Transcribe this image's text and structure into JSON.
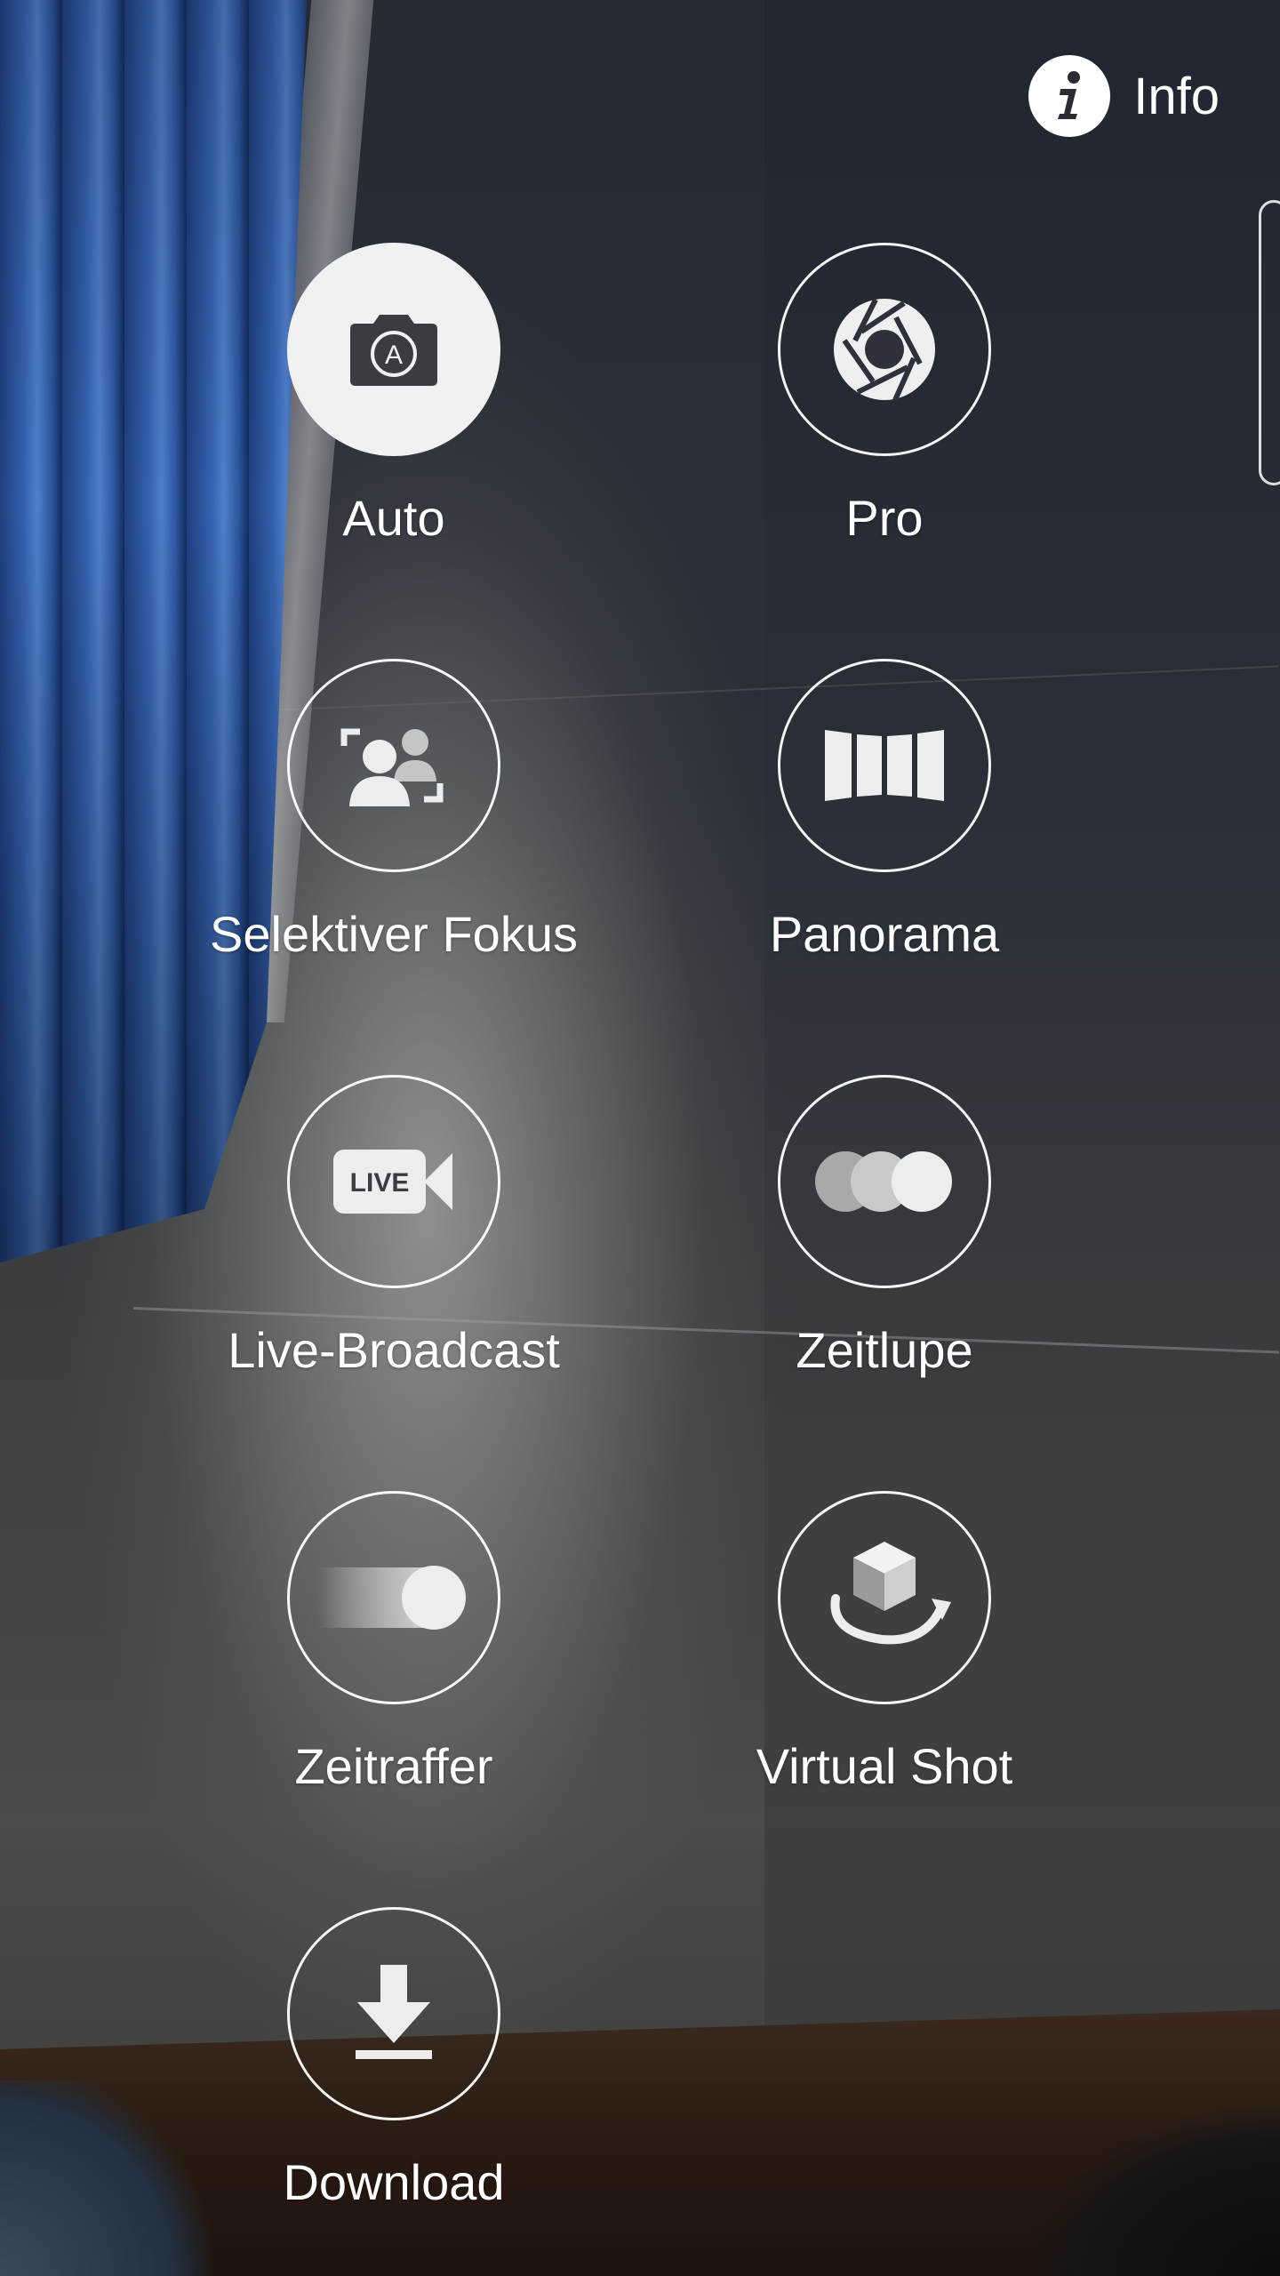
{
  "info": {
    "label": "Info",
    "icon": "info-icon"
  },
  "modes": [
    {
      "label": "Auto",
      "icon": "camera-auto-icon",
      "selected": true
    },
    {
      "label": "Pro",
      "icon": "aperture-icon"
    },
    {
      "label": "Selektiver Fokus",
      "icon": "selective-focus-icon"
    },
    {
      "label": "Panorama",
      "icon": "panorama-icon"
    },
    {
      "label": "Live-Broadcast",
      "icon": "live-video-icon",
      "icon_text": "LIVE"
    },
    {
      "label": "Zeitlupe",
      "icon": "slow-motion-icon"
    },
    {
      "label": "Zeitraffer",
      "icon": "hyperlapse-icon"
    },
    {
      "label": "Virtual Shot",
      "icon": "virtual-shot-icon"
    },
    {
      "label": "Download",
      "icon": "download-icon"
    }
  ],
  "colors": {
    "accent": "#ffffff",
    "selected_fill": "#f1f1f1",
    "icon_dark": "#3a3c42"
  }
}
